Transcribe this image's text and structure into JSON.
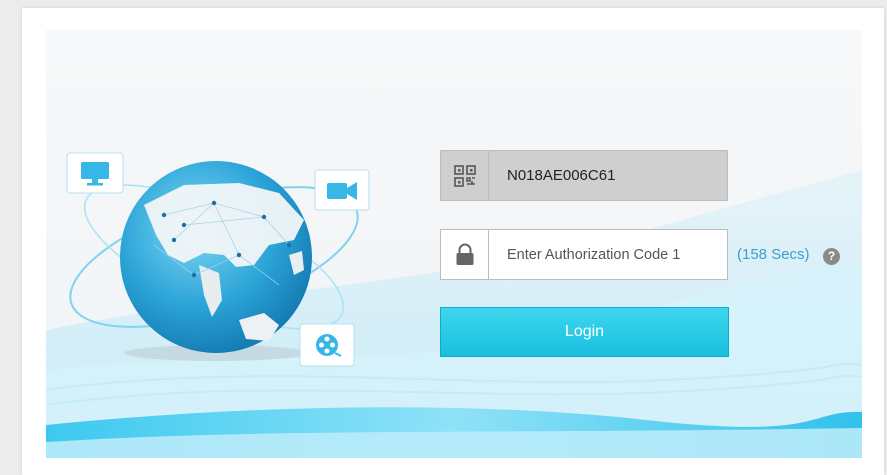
{
  "login_form": {
    "device_id": "N018AE006C61",
    "auth_placeholder": "Enter Authorization Code 1",
    "countdown": "(158 Secs)",
    "help_glyph": "?",
    "login_label": "Login"
  },
  "icons": {
    "device": "qr-code-icon",
    "auth": "lock-icon",
    "monitor": "monitor-icon",
    "camera": "video-camera-icon",
    "film": "film-reel-icon"
  },
  "colors": {
    "accent": "#1fc6e6",
    "countdown_text": "#3a9fd0",
    "device_field_bg": "#cfcfcf"
  }
}
